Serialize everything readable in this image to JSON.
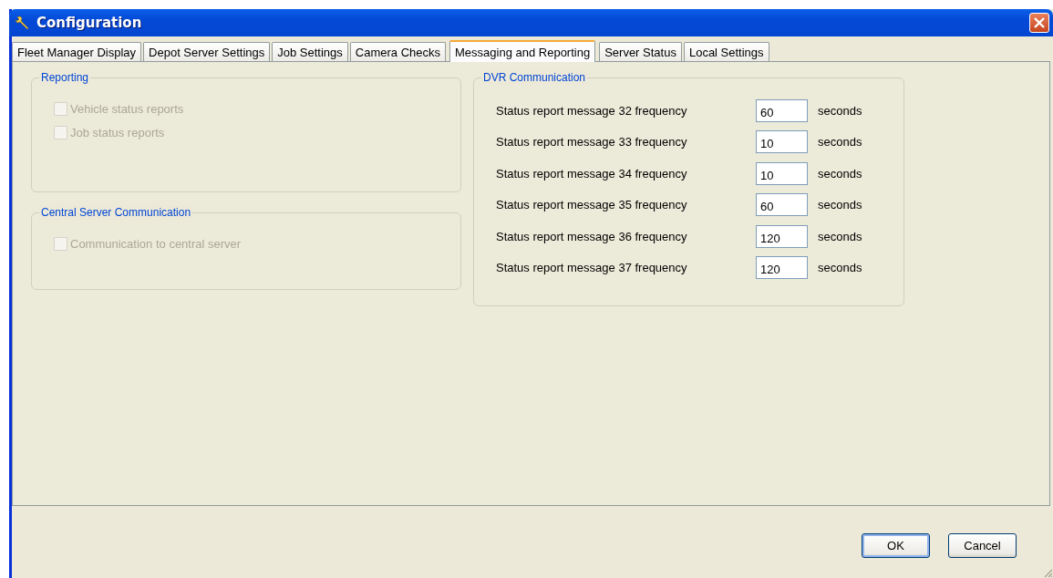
{
  "window": {
    "title": "Configuration"
  },
  "tabs": [
    {
      "label": "Fleet Manager Display",
      "selected": false
    },
    {
      "label": "Depot Server Settings",
      "selected": false
    },
    {
      "label": "Job Settings",
      "selected": false
    },
    {
      "label": "Camera Checks",
      "selected": false
    },
    {
      "label": "Messaging and Reporting",
      "selected": true
    },
    {
      "label": "Server Status",
      "selected": false
    },
    {
      "label": "Local Settings",
      "selected": false
    }
  ],
  "reporting": {
    "title": "Reporting",
    "options": [
      {
        "label": "Vehicle status reports",
        "checked": false,
        "disabled": true
      },
      {
        "label": "Job status reports",
        "checked": false,
        "disabled": true
      }
    ]
  },
  "central_server": {
    "title": "Central Server Communication",
    "options": [
      {
        "label": "Communication to central server",
        "checked": false,
        "disabled": true
      }
    ]
  },
  "dvr": {
    "title": "DVR Communication",
    "rows": [
      {
        "label": "Status report message 32 frequency",
        "value": "60",
        "unit": "seconds"
      },
      {
        "label": "Status report message 33 frequency",
        "value": "10",
        "unit": "seconds"
      },
      {
        "label": "Status report message 34 frequency",
        "value": "10",
        "unit": "seconds"
      },
      {
        "label": "Status report message 35 frequency",
        "value": "60",
        "unit": "seconds"
      },
      {
        "label": "Status report message 36 frequency",
        "value": "120",
        "unit": "seconds"
      },
      {
        "label": "Status report message 37 frequency",
        "value": "120",
        "unit": "seconds"
      }
    ]
  },
  "buttons": [
    {
      "label": "OK",
      "default": true
    },
    {
      "label": "Cancel",
      "default": false
    }
  ]
}
